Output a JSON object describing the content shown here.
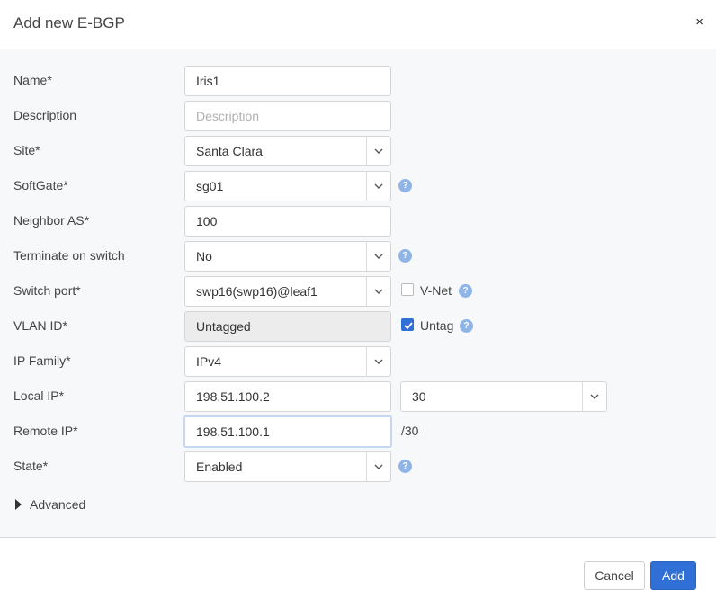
{
  "dialog": {
    "title": "Add new E-BGP",
    "close_glyph": "×"
  },
  "form": {
    "name": {
      "label": "Name*",
      "value": "Iris1"
    },
    "description": {
      "label": "Description",
      "value": "",
      "placeholder": "Description"
    },
    "site": {
      "label": "Site*",
      "value": "Santa Clara"
    },
    "softgate": {
      "label": "SoftGate*",
      "value": "sg01"
    },
    "neighbor_as": {
      "label": "Neighbor AS*",
      "value": "100"
    },
    "terminate_on_switch": {
      "label": "Terminate on switch",
      "value": "No"
    },
    "switch_port": {
      "label": "Switch port*",
      "value": "swp16(swp16)@leaf1",
      "vnet_label": "V-Net",
      "vnet_checked": false
    },
    "vlan_id": {
      "label": "VLAN ID*",
      "value": "Untagged",
      "untag_label": "Untag",
      "untag_checked": true
    },
    "ip_family": {
      "label": "IP Family*",
      "value": "IPv4"
    },
    "local_ip": {
      "label": "Local IP*",
      "value": "198.51.100.2",
      "prefix": "30"
    },
    "remote_ip": {
      "label": "Remote IP*",
      "value": "198.51.100.1",
      "suffix": "/30"
    },
    "state": {
      "label": "State*",
      "value": "Enabled"
    },
    "advanced_label": "Advanced"
  },
  "help_glyph": "?",
  "footer": {
    "cancel_label": "Cancel",
    "add_label": "Add"
  },
  "colors": {
    "primary": "#2f6fd6",
    "help": "#8fb4e8",
    "body_bg": "#f7f8fa"
  },
  "icons": {
    "close": "close-icon",
    "chevron": "chevron-down-icon",
    "help": "help-icon",
    "expand": "caret-right-icon",
    "check": "checkmark-icon"
  }
}
